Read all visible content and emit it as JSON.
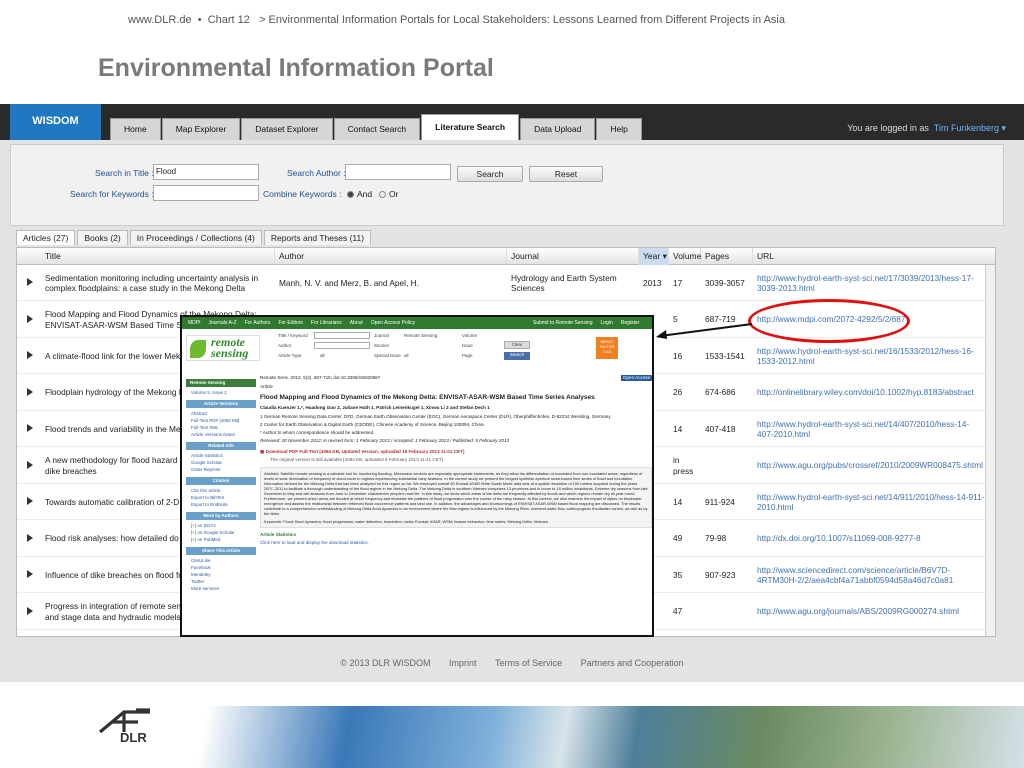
{
  "breadcrumb": {
    "site": "www.DLR.de",
    "sep": "•",
    "chart": "Chart 12",
    "path": "> Environmental Information Portals for Local Stakeholders: Lessons Learned from Different Projects in Asia"
  },
  "page_title": "Environmental Information Portal",
  "app": {
    "logo": "WISDOM",
    "tabs": [
      "Home",
      "Map Explorer",
      "Dataset Explorer",
      "Contact Search",
      "Literature Search",
      "Data Upload",
      "Help"
    ],
    "active_tab": "Literature Search",
    "logged_in_text": "You are logged in as",
    "user": "Tim Funkenberg ▾"
  },
  "search": {
    "title_label": "Search in Title :",
    "title_value": "Flood",
    "author_label": "Search Author :",
    "author_value": "",
    "keywords_label": "Search for Keywords :",
    "keywords_value": "",
    "combine_label": "Combine Keywords :",
    "and": "And",
    "or": "Or",
    "search_btn": "Search",
    "reset_btn": "Reset"
  },
  "filter_tabs": [
    "Articles (27)",
    "Books (2)",
    "In Proceedings / Collections (4)",
    "Reports and Theses (11)"
  ],
  "columns": [
    "Title",
    "Author",
    "Journal",
    "Year",
    "Volume",
    "Pages",
    "URL"
  ],
  "rows": [
    {
      "title": "Sedimentation monitoring including uncertainty analysis in complex floodplains: a case study in the Mekong Delta",
      "author": "Manh, N. V. and Merz, B. and Apel, H.",
      "journal": "Hydrology and Earth System Sciences",
      "year": "2013",
      "volume": "17",
      "pages": "3039-3057",
      "url": "http://www.hydrol-earth-syst-sci.net/17/3039/2013/hess-17-3039-2013.html"
    },
    {
      "title": "Flood Mapping and Flood Dynamics of the Mekong Delta: ENVISAT-ASAR-WSM Based Time Series Analyses",
      "author": "",
      "journal": "",
      "year": "3",
      "volume": "5",
      "pages": "687-719",
      "url": "http://www.mdpi.com/2072-4292/5/2/687"
    },
    {
      "title": "A climate-flood link for the lower Mekong",
      "author": "",
      "journal": "",
      "year": "2",
      "volume": "16",
      "pages": "1533-1541",
      "url": "http://www.hydrol-earth-syst-sci.net/16/1533/2012/hess-16-1533-2012.html"
    },
    {
      "title": "Floodplain hydrology of the Mekong Delta",
      "author": "",
      "journal": "",
      "year": "2",
      "volume": "26",
      "pages": "674-686",
      "url": "http://onlinelibrary.wiley.com/doi/10.1002/hyp.8183/abstract"
    },
    {
      "title": "Flood trends and variability in the Mekong",
      "author": "",
      "journal": "",
      "year": "0",
      "volume": "14",
      "pages": "407-418",
      "url": "http://www.hydrol-earth-syst-sci.net/14/407/2010/hess-14-407-2010.html"
    },
    {
      "title": "A new methodology for flood hazard assessment considering dike breaches",
      "author": "",
      "journal": "",
      "year": "0",
      "volume": "in press",
      "pages": "",
      "url": "http://www.agu.org/pubs/crossref/2010/2009WR008475.shtml"
    },
    {
      "title": "Towards automatic calibration of 2-D flood propagation models",
      "author": "",
      "journal": "",
      "year": "9",
      "volume": "14",
      "pages": "911-924",
      "url": "http://www.hydrol-earth-syst-sci.net/14/911/2010/hess-14-911-2010.html"
    },
    {
      "title": "Flood risk analyses: how detailed do we need to be?",
      "author": "",
      "journal": "",
      "year": "9",
      "volume": "49",
      "pages": "79-98",
      "url": "http://dx.doi.org/10.1007/s11069-008-9277-8"
    },
    {
      "title": "Influence of dike breaches on flood frequency",
      "author": "",
      "journal": "",
      "year": "9",
      "volume": "35",
      "pages": "907-923",
      "url": "http://www.sciencedirect.com/science/article/B6V7D-4RTM30H-2/2/aea4cbf4a71abbf0594d58a46d7c0a81"
    },
    {
      "title": "Progress in integration of remote sensing derived flood extent and stage data and hydraulic models",
      "author": "",
      "journal": "",
      "year": "9",
      "volume": "47",
      "pages": "",
      "url": "http://www.agu.org/journals/ABS/2009RG000274.shtml"
    }
  ],
  "footer": [
    "© 2013 DLR WISDOM",
    "Imprint",
    "Terms of Service",
    "Partners and Cooperation"
  ],
  "overlay": {
    "nav": [
      "MDPI",
      "Journals A-Z",
      "For Authors",
      "For Editors",
      "For Librarians",
      "About",
      "Open Access Policy",
      "Submit to Remote Sensing",
      "Login",
      "Register"
    ],
    "logo_line1": "remote",
    "logo_line2": "sensing",
    "impact": "IMPACT FACTOR 2.101",
    "search_fields": [
      "Title / Keyword",
      "Author",
      "Article Type",
      "Journal",
      "Section",
      "Special Issue",
      "Volume",
      "Issue",
      "Page"
    ],
    "journal_value": "Remote Sensing",
    "type_value": "all",
    "special_value": "all",
    "clear_btn": "Clear",
    "search_btn": "Search",
    "side_sections": [
      {
        "head": "Remote Sensing",
        "items": [
          "Volume 5, Issue 2"
        ]
      },
      {
        "head": "Article Versions",
        "items": [
          "Abstract",
          "Full-Text PDF [4084 KB]",
          "Full-Text XML",
          "Article Versions Notes"
        ]
      },
      {
        "head": "Related Info",
        "items": [
          "Article Statistics",
          "Google Scholar",
          "Order Reprints"
        ]
      },
      {
        "head": "Citation",
        "items": [
          "Cite this article",
          "Export to BibTeX",
          "Export to EndNote"
        ]
      },
      {
        "head": "More by Authors",
        "items": [
          "[+] on DOAJ",
          "[+] on Google Scholar",
          "[+] on PubMed"
        ]
      },
      {
        "head": "Share This Article",
        "items": [
          "CiteULike",
          "Facebook",
          "Mendeley",
          "Twitter",
          "More services"
        ]
      }
    ],
    "citation": "Remote Sens. 2013, 5(2), 687-715; doi:10.3390/rs5020687",
    "open_access": "Open Access",
    "kind": "Article",
    "title": "Flood Mapping and Flood Dynamics of the Mekong Delta: ENVISAT-ASAR-WSM Based Time Series Analyses",
    "authors": "Claudia Kuenzer 1,*, Huadong Guo 2, Juliane Huth 1, Patrick Leinenkugel 1, Xinwu Li 2 and Stefan Dech 1",
    "aff1": "1 German Remote Sensing Data Center, DFD, German Earth Observation Center (EOC), German Aerospace Center (DLR), Oberpfaffenhofen, D-82234 Wessling, Germany",
    "aff2": "2 Center for Earth Observation & Digital Earth (CEODE), Chinese Academy of Science, Beijing 100094, China",
    "corr": "* Author to whom correspondence should be addressed.",
    "received": "Received: 20 November 2012; in revised form: 1 February 2013 / Accepted: 1 February 2013 / Published: 5 February 2013",
    "pdf": "Download PDF Full-Text [4084 KB, Updated Version, uploaded 15 February 2013 11:01 CET]",
    "orig": "The original version is still available [4084 KB, uploaded 5 February 2013 11:21 CET]",
    "abstract": "Abstract: Satellite remote sensing is a valuable tool for monitoring flooding. Microwave sensors are especially appropriate instruments, as they allow the differentiation of inundated from non-inundated areas, regardless of levels of solar illumination or frequency of cloud cover in regions experiencing substantial rainy seasons. In the current study we present the longest synthetic aperture radar-based time series of flood and inundation information derived for the Mekong Delta that has been analyzed for this region so far. We employed overall 60 Envisat ASAR Wide Swath Mode data sets at a spatial resolution of 150 meters acquired during the years 2007–2011 to facilitate a thorough understanding of the flood regime in the Mekong Delta. The Mekong Delta in southern Vietnam comprises 13 provinces and is home to 18 million inhabitants. Extreme dry seasons from late December to May and wet seasons from June to December characterize people's rural life. In this study, we show which areas of the delta are frequently affected by floods and which regions remain dry all year round. Furthermore, we present which areas are flooded at which frequency and elucidate the patterns of flood progression over the course of the rainy season. In this context, we also examine the impact of dykes on floodwater emergence and assess the relationship between retrieved flood occurrence patterns and land use. In addition, the advantages and shortcomings of ENVISAT ASAR-WSM based flood mapping are discussed. The results contribute to a comprehensive understanding of Mekong Delta flood dynamics in an environment where the flow regime is influenced by the Mekong River, overland water-flow, anthropogenic floodwater control, as well as by the tides.",
    "keywords": "Keywords: Flood; flood dynamics; flood progression; water detection; inundation; radar; Envisat; ASAR; WSM; feature extraction; time series; Mekong Delta; Vietnam",
    "stats_head": "Article Statistics",
    "stats_link": "Click here to load and display the download statistics."
  },
  "dlr_logo": "DLR"
}
